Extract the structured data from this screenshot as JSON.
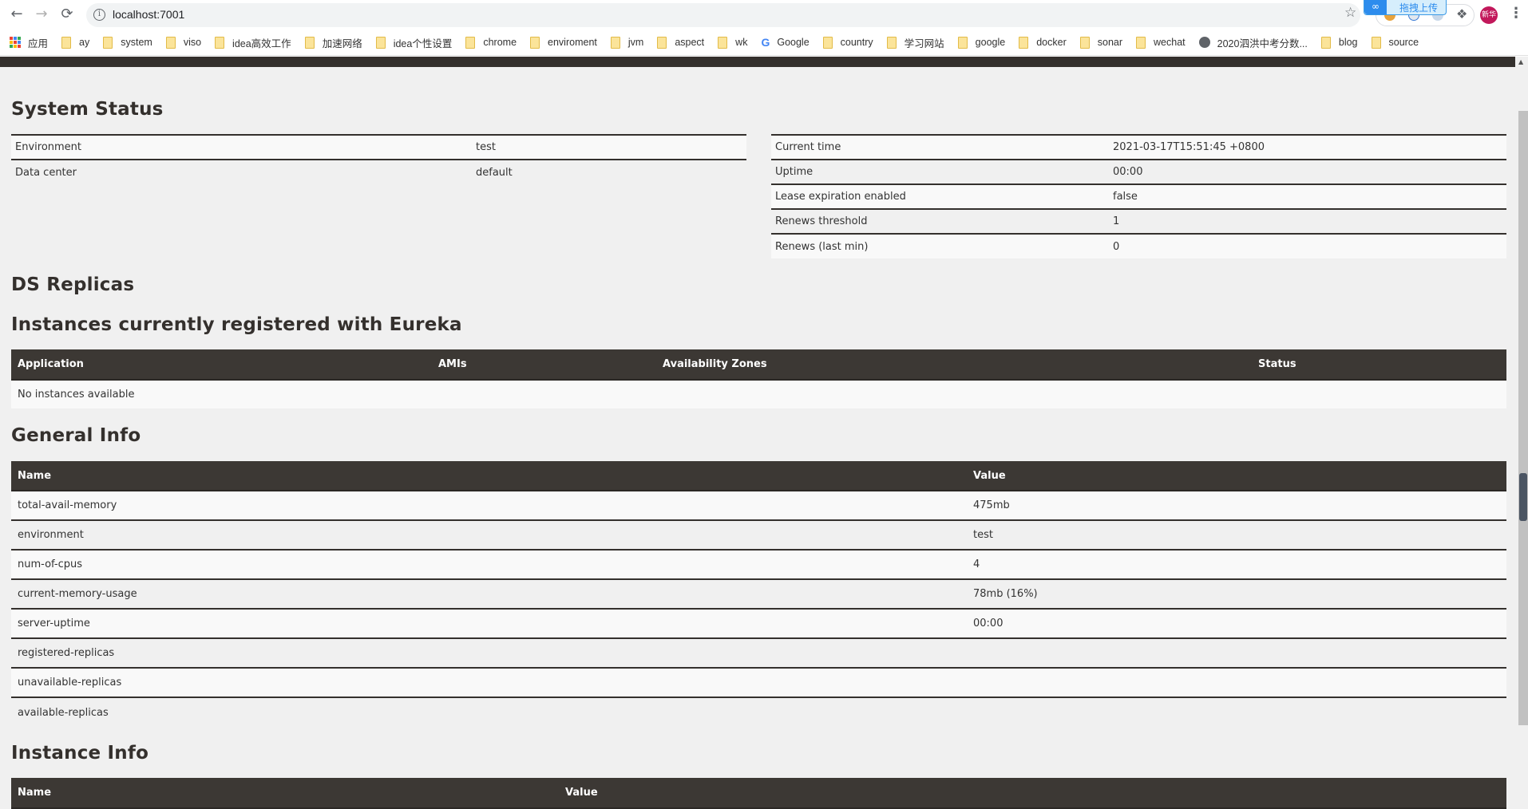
{
  "browser": {
    "url": "localhost:7001",
    "upload_badge": "拖拽上传",
    "avatar_text": "新华",
    "bookmarks": [
      {
        "label": "应用",
        "icon": "apps-icon"
      },
      {
        "label": "ay",
        "icon": "folder-icon"
      },
      {
        "label": "system",
        "icon": "folder-icon"
      },
      {
        "label": "viso",
        "icon": "folder-icon"
      },
      {
        "label": "idea高效工作",
        "icon": "folder-icon"
      },
      {
        "label": "加速网络",
        "icon": "folder-icon"
      },
      {
        "label": "idea个性设置",
        "icon": "folder-icon"
      },
      {
        "label": "chrome",
        "icon": "folder-icon"
      },
      {
        "label": "enviroment",
        "icon": "folder-icon"
      },
      {
        "label": "jvm",
        "icon": "folder-icon"
      },
      {
        "label": "aspect",
        "icon": "folder-icon"
      },
      {
        "label": "wk",
        "icon": "folder-icon"
      },
      {
        "label": "Google",
        "icon": "google-icon"
      },
      {
        "label": "country",
        "icon": "folder-icon"
      },
      {
        "label": "学习网站",
        "icon": "folder-icon"
      },
      {
        "label": "google",
        "icon": "folder-icon"
      },
      {
        "label": "docker",
        "icon": "folder-icon"
      },
      {
        "label": "sonar",
        "icon": "folder-icon"
      },
      {
        "label": "wechat",
        "icon": "folder-icon"
      },
      {
        "label": "2020泗洪中考分数...",
        "icon": "globe-icon"
      },
      {
        "label": "blog",
        "icon": "folder-icon"
      },
      {
        "label": "source",
        "icon": "folder-icon"
      }
    ]
  },
  "system_status": {
    "title": "System Status",
    "left": [
      {
        "label": "Environment",
        "value": "test"
      },
      {
        "label": "Data center",
        "value": "default"
      }
    ],
    "right": [
      {
        "label": "Current time",
        "value": "2021-03-17T15:51:45 +0800"
      },
      {
        "label": "Uptime",
        "value": "00:00"
      },
      {
        "label": "Lease expiration enabled",
        "value": "false"
      },
      {
        "label": "Renews threshold",
        "value": "1"
      },
      {
        "label": "Renews (last min)",
        "value": "0"
      }
    ]
  },
  "ds_replicas": {
    "title": "DS Replicas"
  },
  "instances": {
    "title": "Instances currently registered with Eureka",
    "columns": [
      "Application",
      "AMIs",
      "Availability Zones",
      "Status"
    ],
    "empty_message": "No instances available"
  },
  "general_info": {
    "title": "General Info",
    "columns": [
      "Name",
      "Value"
    ],
    "rows": [
      {
        "name": "total-avail-memory",
        "value": "475mb"
      },
      {
        "name": "environment",
        "value": "test"
      },
      {
        "name": "num-of-cpus",
        "value": "4"
      },
      {
        "name": "current-memory-usage",
        "value": "78mb (16%)"
      },
      {
        "name": "server-uptime",
        "value": "00:00"
      },
      {
        "name": "registered-replicas",
        "value": ""
      },
      {
        "name": "unavailable-replicas",
        "value": ""
      },
      {
        "name": "available-replicas",
        "value": ""
      }
    ]
  },
  "instance_info": {
    "title": "Instance Info",
    "columns": [
      "Name",
      "Value"
    ]
  }
}
